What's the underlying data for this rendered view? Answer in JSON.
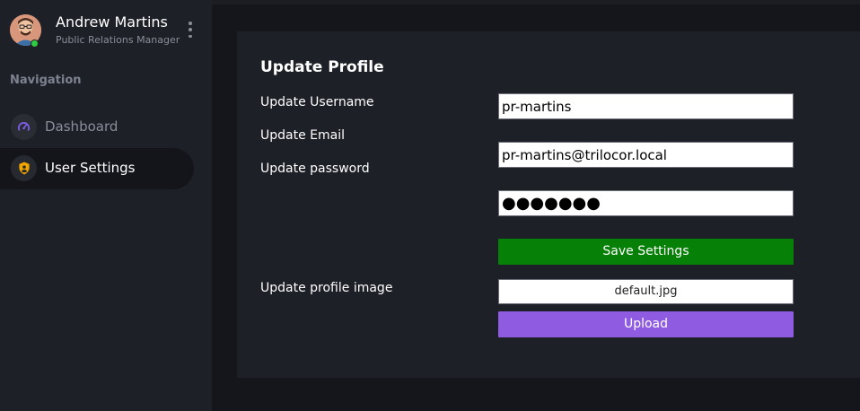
{
  "user": {
    "name": "Andrew Martins",
    "role": "Public Relations Manager",
    "status": "online",
    "status_color": "#2ecc40"
  },
  "nav": {
    "heading": "Navigation",
    "items": [
      {
        "label": "Dashboard",
        "icon": "speedometer-icon",
        "active": false,
        "icon_color": "#7c5ce0"
      },
      {
        "label": "User Settings",
        "icon": "shield-icon",
        "active": true,
        "icon_color": "#f0a500"
      }
    ]
  },
  "form": {
    "title": "Update Profile",
    "labels": {
      "username": "Update Username",
      "email": "Update Email",
      "password": "Update password",
      "image": "Update profile image"
    },
    "values": {
      "username": "pr-martins",
      "email": "pr-martins@trilocor.local",
      "password": "●●●●●●●",
      "image_file": "default.jpg"
    },
    "save_label": "Save Settings",
    "upload_label": "Upload"
  },
  "colors": {
    "save_button": "#068006",
    "upload_button": "#8f5be0",
    "sidebar_bg": "#1e2027",
    "main_bg": "#15161b"
  }
}
